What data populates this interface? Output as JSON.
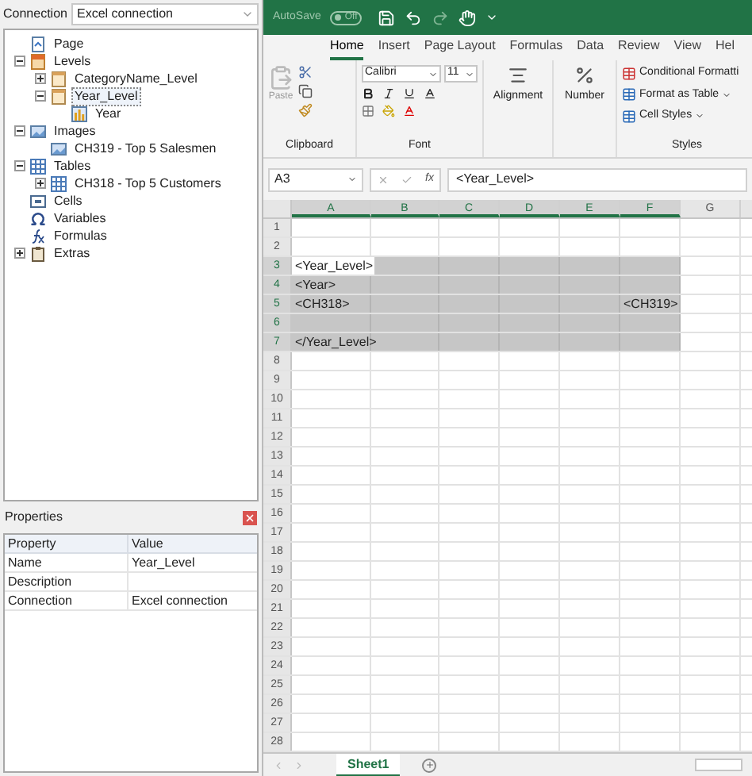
{
  "connection": {
    "label": "Connection",
    "value": "Excel connection"
  },
  "tree": [
    {
      "kind": "page",
      "label": "Page",
      "selected": false
    },
    {
      "kind": "levels",
      "label": "Levels",
      "selected": false,
      "expanded": true,
      "children": [
        {
          "kind": "level",
          "label": "CategoryName_Level",
          "selected": false,
          "expanded": false
        },
        {
          "kind": "level",
          "label": "Year_Level",
          "selected": true,
          "expanded": true,
          "children": [
            {
              "kind": "chart",
              "label": "Year",
              "selected": false
            }
          ]
        }
      ]
    },
    {
      "kind": "images",
      "label": "Images",
      "selected": false,
      "expanded": true,
      "children": [
        {
          "kind": "image",
          "label": "CH319 - Top 5 Salesmen",
          "selected": false
        }
      ]
    },
    {
      "kind": "tables",
      "label": "Tables",
      "selected": false,
      "expanded": true,
      "children": [
        {
          "kind": "table",
          "label": "CH318 - Top 5 Customers",
          "selected": false,
          "expanded": false
        }
      ]
    },
    {
      "kind": "cells",
      "label": "Cells",
      "selected": false
    },
    {
      "kind": "variables",
      "label": "Variables",
      "selected": false
    },
    {
      "kind": "formulas",
      "label": "Formulas",
      "selected": false
    },
    {
      "kind": "extras",
      "label": "Extras",
      "selected": false,
      "expanded": false
    }
  ],
  "properties": {
    "title": "Properties",
    "columns": [
      "Property",
      "Value"
    ],
    "rows": [
      [
        "Name",
        "Year_Level"
      ],
      [
        "Description",
        ""
      ],
      [
        "Connection",
        "Excel connection"
      ]
    ]
  },
  "excel": {
    "autosave": {
      "label": "AutoSave",
      "toggle": "Off",
      "on": false
    },
    "tabs": [
      {
        "label": "Home",
        "selected": true
      },
      {
        "label": "Insert",
        "selected": false
      },
      {
        "label": "Page Layout",
        "selected": false
      },
      {
        "label": "Formulas",
        "selected": false
      },
      {
        "label": "Data",
        "selected": false
      },
      {
        "label": "Review",
        "selected": false
      },
      {
        "label": "View",
        "selected": false
      },
      {
        "label": "Hel",
        "selected": false
      }
    ],
    "ribbon": {
      "paste": "Paste",
      "font": "Calibri",
      "size": "11",
      "alignment": "Alignment",
      "number": "Number",
      "conditional": "Conditional Formatti",
      "format_table": "Format as Table",
      "cell_styles": "Cell Styles",
      "groups": [
        "Clipboard",
        "Font",
        "Styles"
      ]
    },
    "name_box": "A3",
    "fx": "fx",
    "formula": "<Year_Level>",
    "columns": [
      {
        "label": "A",
        "selected": true
      },
      {
        "label": "B",
        "selected": true
      },
      {
        "label": "C",
        "selected": true
      },
      {
        "label": "D",
        "selected": true
      },
      {
        "label": "E",
        "selected": true
      },
      {
        "label": "F",
        "selected": true
      },
      {
        "label": "G",
        "selected": false
      }
    ],
    "rows": [
      {
        "label": "1",
        "selected": false
      },
      {
        "label": "2",
        "selected": false
      },
      {
        "label": "3",
        "selected": true,
        "cells": [
          {
            "text": "<Year_Level>",
            "active": true
          }
        ]
      },
      {
        "label": "4",
        "selected": true,
        "cells": [
          {
            "text": "<Year>"
          }
        ]
      },
      {
        "label": "5",
        "selected": true,
        "cells": [
          {
            "text": "<CH318>"
          },
          {},
          {},
          {},
          {},
          {
            "text": "<CH319>"
          }
        ]
      },
      {
        "label": "6",
        "selected": true
      },
      {
        "label": "7",
        "selected": true,
        "cells": [
          {
            "text": "</Year_Level>"
          }
        ]
      },
      {
        "label": "8",
        "selected": false
      },
      {
        "label": "9",
        "selected": false
      },
      {
        "label": "10",
        "selected": false
      },
      {
        "label": "11",
        "selected": false
      },
      {
        "label": "12",
        "selected": false
      },
      {
        "label": "13",
        "selected": false
      },
      {
        "label": "14",
        "selected": false
      },
      {
        "label": "15",
        "selected": false
      },
      {
        "label": "16",
        "selected": false
      },
      {
        "label": "17",
        "selected": false
      },
      {
        "label": "18",
        "selected": false
      },
      {
        "label": "19",
        "selected": false
      },
      {
        "label": "20",
        "selected": false
      },
      {
        "label": "21",
        "selected": false
      },
      {
        "label": "22",
        "selected": false
      },
      {
        "label": "23",
        "selected": false
      },
      {
        "label": "24",
        "selected": false
      },
      {
        "label": "25",
        "selected": false
      },
      {
        "label": "26",
        "selected": false
      },
      {
        "label": "27",
        "selected": false
      },
      {
        "label": "28",
        "selected": false
      }
    ],
    "sheets": [
      {
        "label": "Sheet1",
        "selected": true
      }
    ]
  }
}
